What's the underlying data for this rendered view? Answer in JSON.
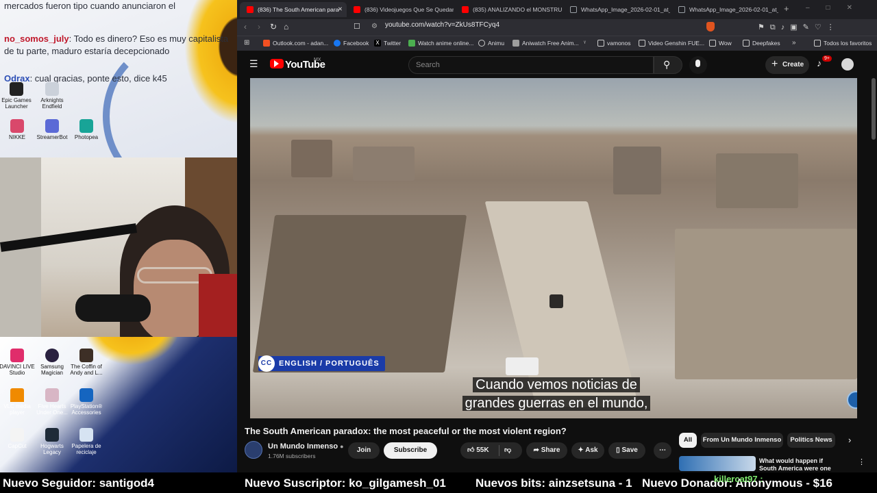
{
  "stream": {
    "chat": [
      {
        "user": "",
        "text": "mercados fueron tipo cuando anunciaron el"
      },
      {
        "user": "no_somos_july",
        "text": ": Todo es dinero? Eso es muy capitalista de tu parte, maduro estaría decepcionado"
      },
      {
        "user": "Odrax",
        "text": ": cual gracias, ponte esto, dice k45"
      }
    ],
    "desktop_top_icons": [
      "Epic Games Launcher",
      "Arknights Endfield",
      "NIKKE",
      "StreamerBot",
      "Photopea"
    ],
    "desktop_bottom_icons": [
      "DAVINCI LIVE Studio",
      "Samsung Magician",
      "The Coffin of Andy and L...",
      "VLC media player",
      "Five Hearts Under One...",
      "PlayStation® Accessories",
      "CapCut",
      "Hogwarts Legacy",
      "Papelera de reciclaje"
    ]
  },
  "browser": {
    "tabs": [
      {
        "label": "(836) The South American para",
        "icon": "youtube-icon",
        "active": true
      },
      {
        "label": "(836) Videojuegos Que Se Quedan",
        "icon": "youtube-icon",
        "active": false
      },
      {
        "label": "(835) ANALIZANDO el MONSTRUO",
        "icon": "youtube-icon",
        "active": false
      },
      {
        "label": "WhatsApp_Image_2026-02-01_at_",
        "icon": "globe-icon",
        "active": false
      },
      {
        "label": "WhatsApp_Image_2026-02-01_at_",
        "icon": "globe-icon",
        "active": false
      }
    ],
    "url": "youtube.com/watch?v=ZkUs8TFCyq4",
    "bookmarks": [
      "Outlook.com - adan...",
      "Facebook",
      "Twitter",
      "Watch anime online...",
      "Animu",
      "Aniwatch Free Anim...",
      "vamonos",
      "Video Genshin FUE...",
      "Wow",
      "Deepfakes",
      "Todos los favoritos"
    ]
  },
  "youtube": {
    "logo": "YouTube",
    "region": "MX",
    "search_placeholder": "Search",
    "create_label": "Create",
    "notif_count": "9+",
    "cc_badge": "ENGLISH / PORTUGUÊS",
    "cc_icon": "CC",
    "caption_line1": "Cuando vemos noticias de",
    "caption_line2": "grandes guerras en el mundo,",
    "video_title": "The South American paradox: the most peaceful or the most violent region?",
    "channel_name": "Un Mundo Inmenso",
    "channel_subs": "1.76M subscribers",
    "join_label": "Join",
    "subscribe_label": "Subscribe",
    "likes": "55K",
    "share_label": "Share",
    "ask_label": "Ask",
    "save_label": "Save",
    "chips": [
      "All",
      "From Un Mundo Inmenso",
      "Politics News"
    ],
    "rec_title": "What would happen if South America were one country?"
  },
  "ticker": {
    "follower": "Nuevo Seguidor: santigod4",
    "subscriber": "Nuevo Suscriptor: ko_gilgamesh_01",
    "bits": "Nuevos bits: ainzsetsuna - 1",
    "donor": "Nuevo Donador: Anonymous - $16",
    "overlay_user": "killercat97 :"
  }
}
